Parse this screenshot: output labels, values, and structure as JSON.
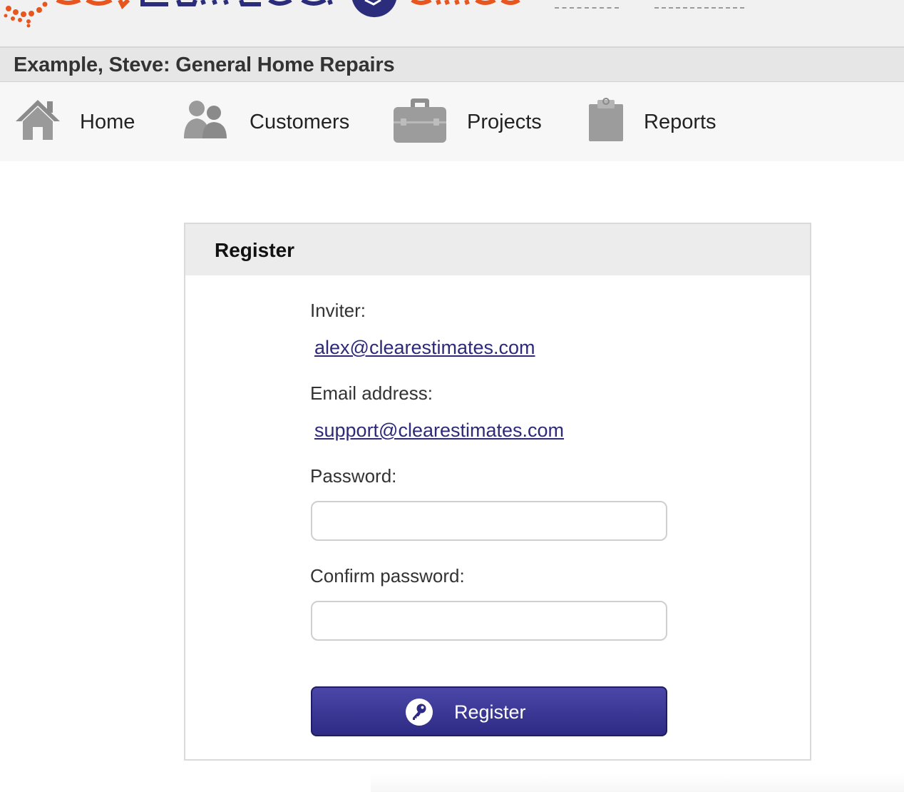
{
  "company": {
    "title": "Example, Steve: General Home Repairs"
  },
  "nav": {
    "home": "Home",
    "customers": "Customers",
    "projects": "Projects",
    "reports": "Reports"
  },
  "register": {
    "heading": "Register",
    "inviter_label": "Inviter:",
    "inviter_email": "alex@clearestimates.com",
    "email_label": "Email address:",
    "email_value": "support@clearestimates.com",
    "password_label": "Password:",
    "password_value": "",
    "confirm_label": "Confirm password:",
    "confirm_value": "",
    "button_label": "Register"
  },
  "icons": {
    "home": "home-icon",
    "customers": "customers-icon",
    "projects": "briefcase-icon",
    "reports": "clipboard-icon",
    "button": "key-icon"
  },
  "colors": {
    "link": "#2d2a78",
    "button": "#3a379a",
    "logo_orange": "#e8561f",
    "logo_navy": "#2b2d7c"
  }
}
